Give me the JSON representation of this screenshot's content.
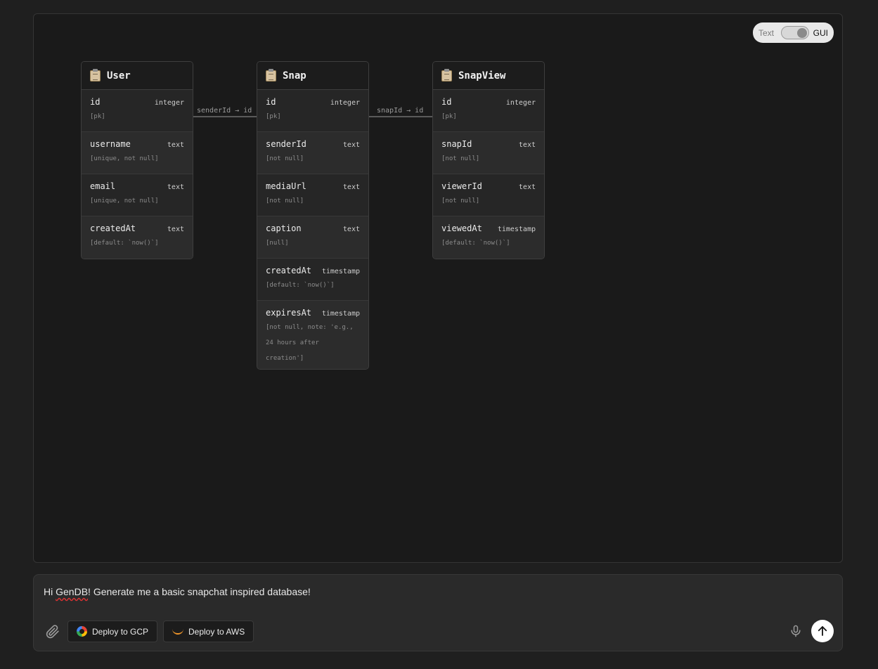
{
  "toggle": {
    "left_label": "Text",
    "right_label": "GUI",
    "active": "GUI"
  },
  "tables": {
    "user": {
      "name": "User",
      "fields": [
        {
          "name": "id",
          "type": "integer",
          "meta": "[pk]"
        },
        {
          "name": "username",
          "type": "text",
          "meta": "[unique, not null]"
        },
        {
          "name": "email",
          "type": "text",
          "meta": "[unique, not null]"
        },
        {
          "name": "createdAt",
          "type": "text",
          "meta": "[default: `now()`]"
        }
      ]
    },
    "snap": {
      "name": "Snap",
      "fields": [
        {
          "name": "id",
          "type": "integer",
          "meta": "[pk]"
        },
        {
          "name": "senderId",
          "type": "text",
          "meta": "[not null]"
        },
        {
          "name": "mediaUrl",
          "type": "text",
          "meta": "[not null]"
        },
        {
          "name": "caption",
          "type": "text",
          "meta": "[null]"
        },
        {
          "name": "createdAt",
          "type": "timestamp",
          "meta": "[default: `now()`]"
        },
        {
          "name": "expiresAt",
          "type": "timestamp",
          "meta": "[not null, note: 'e.g., 24 hours after creation']"
        }
      ]
    },
    "snapview": {
      "name": "SnapView",
      "fields": [
        {
          "name": "id",
          "type": "integer",
          "meta": "[pk]"
        },
        {
          "name": "snapId",
          "type": "text",
          "meta": "[not null]"
        },
        {
          "name": "viewerId",
          "type": "text",
          "meta": "[not null]"
        },
        {
          "name": "viewedAt",
          "type": "timestamp",
          "meta": "[default: `now()`]"
        }
      ]
    }
  },
  "relations": [
    {
      "label": "senderId → id"
    },
    {
      "label": "snapId → id"
    }
  ],
  "composer": {
    "prompt_pre": "Hi ",
    "prompt_flagged": "GenDB",
    "prompt_post": "! Generate me a basic snapchat inspired database!",
    "deploy_gcp_label": "Deploy to GCP",
    "deploy_aws_label": "Deploy to AWS"
  },
  "icons": {
    "attach": "paperclip-icon",
    "mic": "microphone-icon",
    "send": "arrow-up-icon",
    "table": "clipboard-icon"
  }
}
